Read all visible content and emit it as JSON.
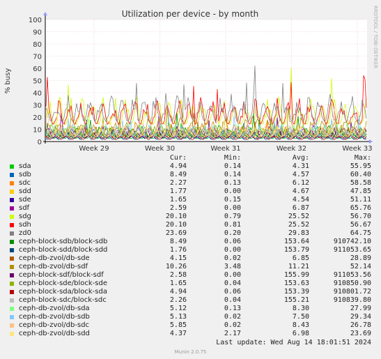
{
  "chart_data": {
    "type": "line",
    "title": "Utilization per device - by month",
    "ylabel": "% busy",
    "ylim": [
      0,
      100
    ],
    "y_ticks": [
      0,
      10,
      20,
      30,
      40,
      50,
      60,
      70,
      80,
      90,
      100
    ],
    "x_ticks": [
      "Week 29",
      "Week 30",
      "Week 31",
      "Week 32",
      "Week 33"
    ],
    "grid": true,
    "side_label": "RRDTOOL / TOBI OETIKER",
    "legend_headers": {
      "cur": "Cur:",
      "min": "Min:",
      "avg": "Avg:",
      "max": "Max:"
    },
    "series": [
      {
        "name": "sda",
        "color": "#00cc00",
        "cur": "4.94",
        "min": "0.14",
        "avg": "4.31",
        "max": "55.95"
      },
      {
        "name": "sdb",
        "color": "#0066b3",
        "cur": "8.49",
        "min": "0.14",
        "avg": "4.57",
        "max": "60.40"
      },
      {
        "name": "sdc",
        "color": "#ff8000",
        "cur": "2.27",
        "min": "0.13",
        "avg": "6.12",
        "max": "58.58"
      },
      {
        "name": "sdd",
        "color": "#ffcc00",
        "cur": "1.77",
        "min": "0.00",
        "avg": "4.67",
        "max": "47.85"
      },
      {
        "name": "sde",
        "color": "#330099",
        "cur": "1.65",
        "min": "0.15",
        "avg": "4.54",
        "max": "51.11"
      },
      {
        "name": "sdf",
        "color": "#990099",
        "cur": "2.59",
        "min": "0.00",
        "avg": "6.87",
        "max": "65.76"
      },
      {
        "name": "sdg",
        "color": "#ccff00",
        "cur": "20.10",
        "min": "0.79",
        "avg": "25.52",
        "max": "56.70"
      },
      {
        "name": "sdh",
        "color": "#ff0000",
        "cur": "20.10",
        "min": "0.81",
        "avg": "25.52",
        "max": "56.67"
      },
      {
        "name": "zd0",
        "color": "#808080",
        "cur": "23.69",
        "min": "0.20",
        "avg": "29.83",
        "max": "64.75"
      },
      {
        "name": "ceph-block-sdb/block-sdb",
        "color": "#008f00",
        "cur": "8.49",
        "min": "0.06",
        "avg": "153.64",
        "max": "910742.10"
      },
      {
        "name": "ceph-block-sdd/block-sdd",
        "color": "#00487d",
        "cur": "1.76",
        "min": "0.00",
        "avg": "153.79",
        "max": "911053.65"
      },
      {
        "name": "ceph-db-zvol/db-sde",
        "color": "#b35a00",
        "cur": "4.15",
        "min": "0.02",
        "avg": "6.85",
        "max": "28.89"
      },
      {
        "name": "ceph-db-zvol/db-sdf",
        "color": "#b38f00",
        "cur": "10.26",
        "min": "3.48",
        "avg": "11.21",
        "max": "52.14"
      },
      {
        "name": "ceph-block-sdf/block-sdf",
        "color": "#6b006b",
        "cur": "2.58",
        "min": "0.00",
        "avg": "155.99",
        "max": "911053.56"
      },
      {
        "name": "ceph-block-sde/block-sde",
        "color": "#8fb300",
        "cur": "1.65",
        "min": "0.04",
        "avg": "153.63",
        "max": "910850.90"
      },
      {
        "name": "ceph-block-sda/block-sda",
        "color": "#b30000",
        "cur": "4.94",
        "min": "0.06",
        "avg": "153.39",
        "max": "910801.72"
      },
      {
        "name": "ceph-block-sdc/block-sdc",
        "color": "#bebebe",
        "cur": "2.26",
        "min": "0.04",
        "avg": "155.21",
        "max": "910839.80"
      },
      {
        "name": "ceph-db-zvol/db-sda",
        "color": "#80ff80",
        "cur": "5.12",
        "min": "0.13",
        "avg": "8.30",
        "max": "27.99"
      },
      {
        "name": "ceph-db-zvol/db-sdb",
        "color": "#80c9ff",
        "cur": "5.13",
        "min": "0.02",
        "avg": "7.50",
        "max": "29.34"
      },
      {
        "name": "ceph-db-zvol/db-sdc",
        "color": "#ffc080",
        "cur": "5.85",
        "min": "0.02",
        "avg": "8.43",
        "max": "26.78"
      },
      {
        "name": "ceph-db-zvol/db-sdd",
        "color": "#ffe680",
        "cur": "4.37",
        "min": "2.17",
        "avg": "6.98",
        "max": "23.69"
      }
    ]
  },
  "last_update": "Last update: Wed Aug 14 18:01:51 2024",
  "footer": "Munin 2.0.75"
}
